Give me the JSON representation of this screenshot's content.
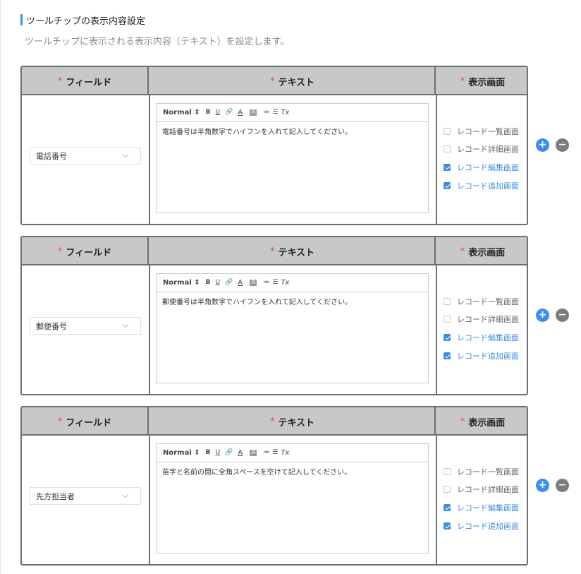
{
  "section": {
    "title": "ツールチップの表示内容設定",
    "description": "ツールチップに表示される表示内容（テキスト）を設定します。"
  },
  "headers": {
    "required_mark": "*",
    "field": "フィールド",
    "text": "テキスト",
    "screen": "表示画面"
  },
  "toolbar": {
    "normal": "Normal",
    "normal_arrow": "⇕",
    "bold": "B",
    "underline": "U",
    "link": "🔗",
    "font_color": "A",
    "background": "A",
    "ordered_list": "≔",
    "bullet_list": "☰",
    "clear": "Tx"
  },
  "buttons": {
    "add": "+",
    "remove": "−"
  },
  "rows": [
    {
      "field": "電話番号",
      "text": "電話番号は半角数字でハイフンを入れて記入してください。",
      "screens": [
        {
          "label": "レコード一覧画面",
          "checked": false
        },
        {
          "label": "レコード詳細画面",
          "checked": false
        },
        {
          "label": "レコード編集画面",
          "checked": true
        },
        {
          "label": "レコード追加画面",
          "checked": true
        }
      ]
    },
    {
      "field": "郵便番号",
      "text": "郵便番号は半角数字でハイフンを入れて記入してください。",
      "screens": [
        {
          "label": "レコード一覧画面",
          "checked": false
        },
        {
          "label": "レコード詳細画面",
          "checked": false
        },
        {
          "label": "レコード編集画面",
          "checked": true
        },
        {
          "label": "レコード追加画面",
          "checked": true
        }
      ]
    },
    {
      "field": "先方担当者",
      "text": "苗字と名前の間に全角スペースを空けて記入してください。",
      "screens": [
        {
          "label": "レコード一覧画面",
          "checked": false
        },
        {
          "label": "レコード詳細画面",
          "checked": false
        },
        {
          "label": "レコード編集画面",
          "checked": true
        },
        {
          "label": "レコード追加画面",
          "checked": true
        }
      ]
    }
  ],
  "colors": {
    "accent": "#3498db",
    "checked": "#3c8ddc",
    "required": "#e0503c",
    "add_button": "#3d8ef0",
    "remove_button": "#7c7c7c"
  }
}
